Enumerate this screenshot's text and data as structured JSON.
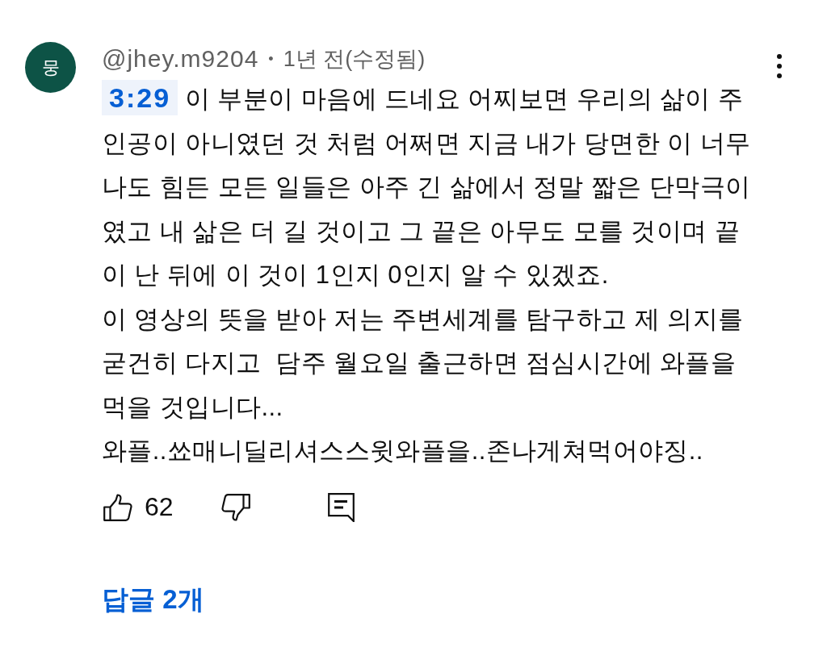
{
  "comment": {
    "avatar_initial": "뭉",
    "author": "@jhey.m9204",
    "separator": "•",
    "time": "1년 전(수정됨)",
    "timestamp_link": "3:29",
    "paragraphs": [
      "이 부분이 마음에 드네요 어찌보면 우리의 삶이 주인공이 아니였던 것 처럼 어쩌면 지금 내가 당면한 이 너무나도 힘든 모든 일들은 아주 긴 삶에서 정말 짧은 단막극이였고 내 삶은 더 길 것이고 그 끝은 아무도 모를 것이며 끝이 난 뒤에 이 것이 1인지 0인지 알 수 있겠죠.",
      "이 영상의 뜻을 받아 저는 주변세계를 탐구하고 제 의지를 굳건히 다지고  담주 월요일 출근하면 점심시간에 와플을 먹을 것입니다...",
      "와플..쑈매니딜리셔스스윗와플을..존나게쳐먹어야징.."
    ],
    "likes": "62",
    "replies": "답글 2개"
  }
}
